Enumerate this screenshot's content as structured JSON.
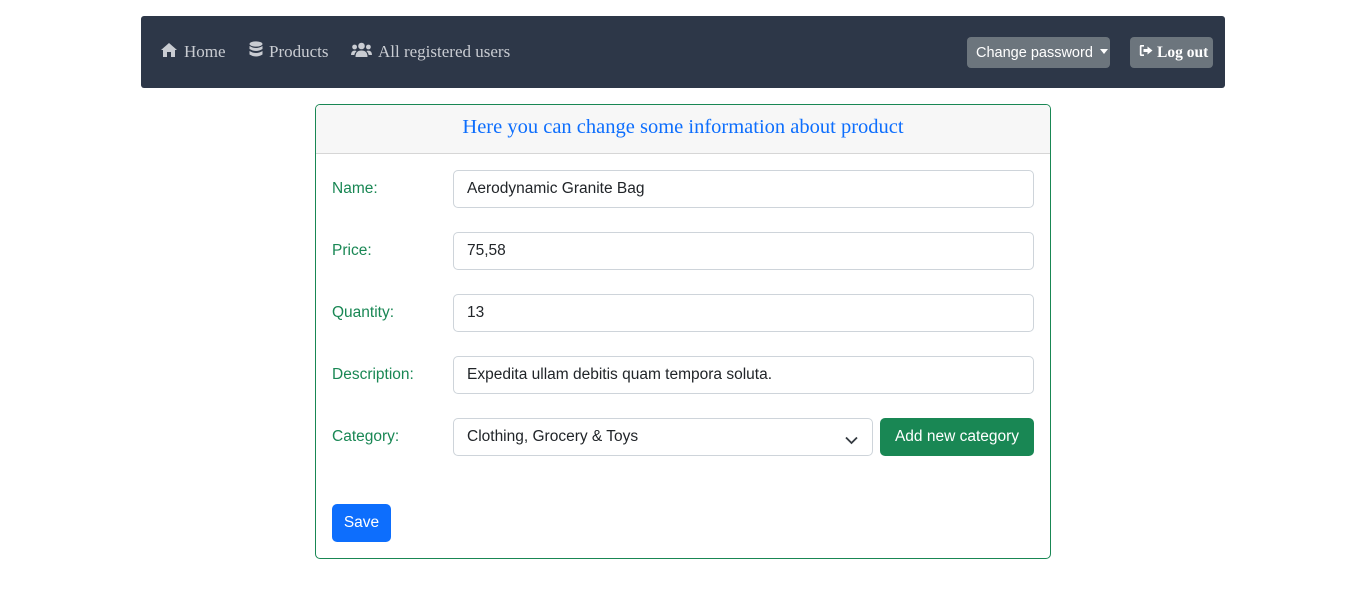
{
  "navbar": {
    "home": {
      "label": "Home",
      "icon": "home-icon"
    },
    "products": {
      "label": "Products",
      "icon": "database-icon"
    },
    "users": {
      "label": "All registered users",
      "icon": "users-icon"
    },
    "change_password_label": "Change password",
    "logout": {
      "label": "Log out",
      "icon": "sign-out-icon"
    }
  },
  "form": {
    "title": "Here you can change some information about product",
    "fields": {
      "name": {
        "label": "Name:",
        "value": "Aerodynamic Granite Bag"
      },
      "price": {
        "label": "Price:",
        "value": "75,58"
      },
      "quantity": {
        "label": "Quantity:",
        "value": "13"
      },
      "description": {
        "label": "Description:",
        "value": "Expedita ullam debitis quam tempora soluta."
      },
      "category": {
        "label": "Category:",
        "value": "Clothing, Grocery & Toys"
      }
    },
    "add_category_label": "Add new category",
    "save_label": "Save"
  },
  "colors": {
    "navbar_bg": "#2d3748",
    "accent_green": "#198754",
    "accent_blue": "#0d6efd",
    "secondary_grey": "#6c757d"
  }
}
